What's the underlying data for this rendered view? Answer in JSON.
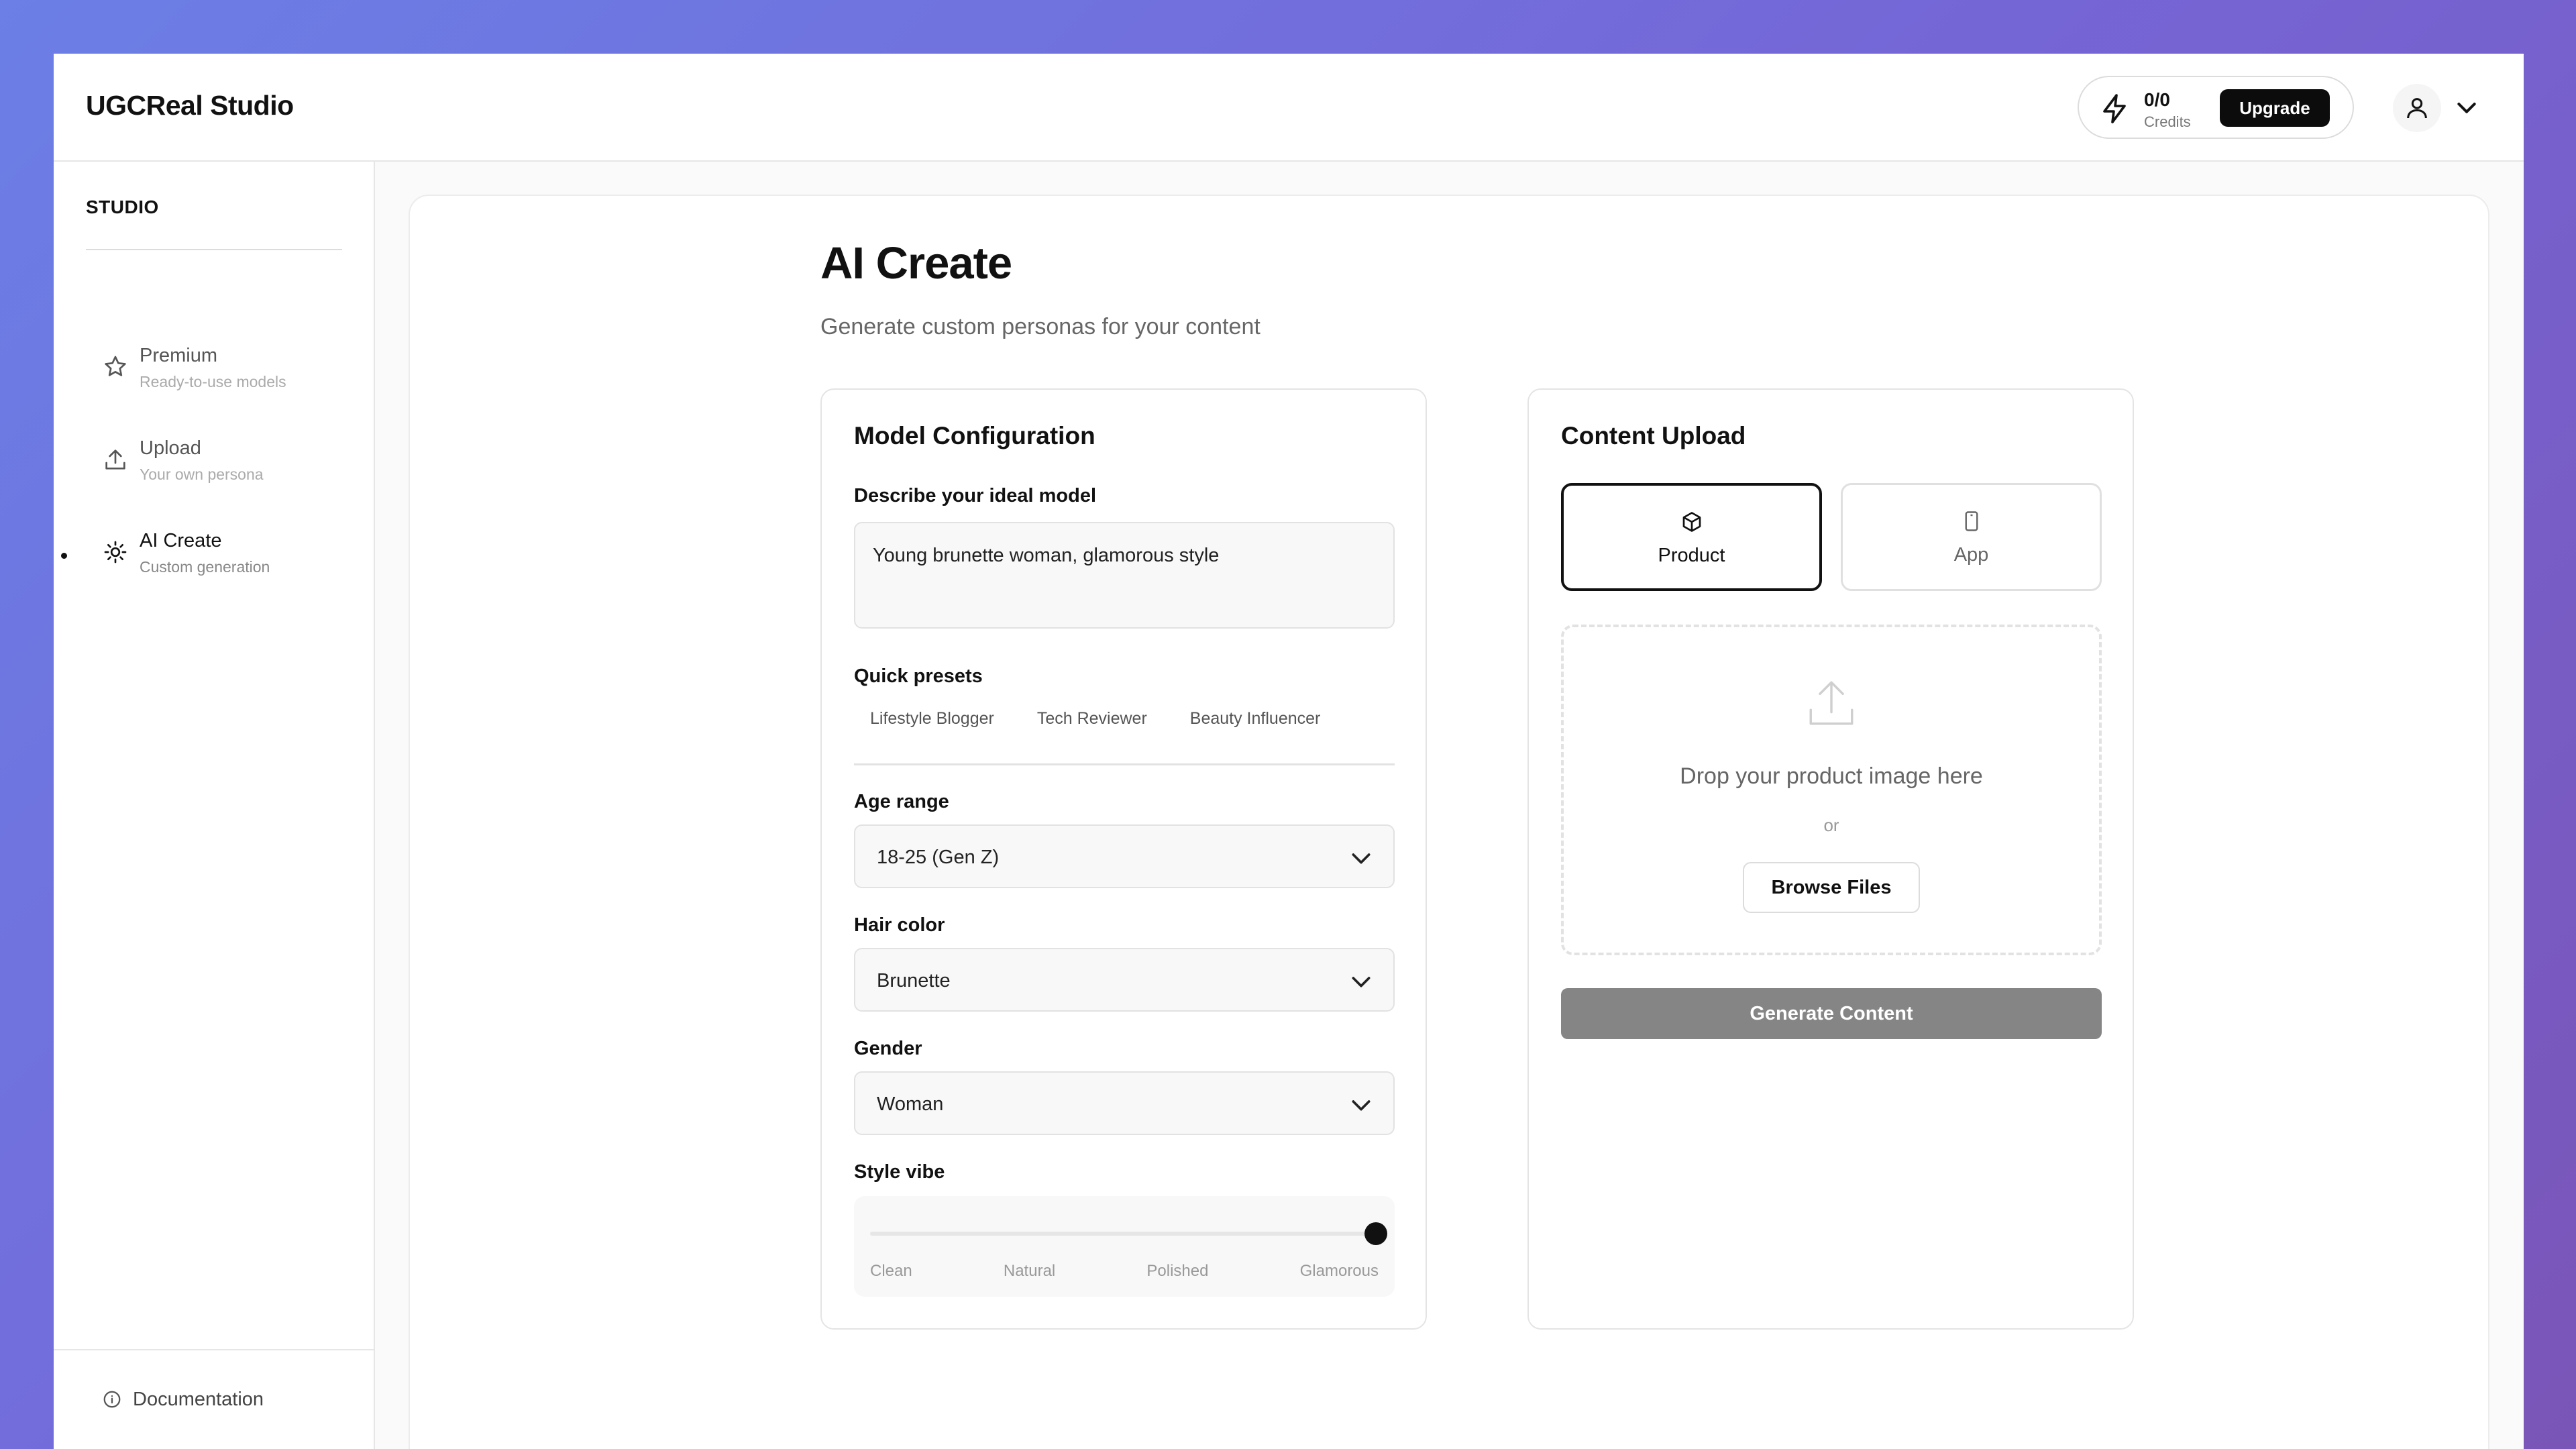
{
  "header": {
    "app_title": "UGCReal Studio",
    "credits_value": "0/0",
    "credits_label": "Credits",
    "upgrade_label": "Upgrade"
  },
  "sidebar": {
    "section_label": "STUDIO",
    "items": [
      {
        "title": "Premium",
        "subtitle": "Ready-to-use models",
        "icon": "star-icon",
        "active": false
      },
      {
        "title": "Upload",
        "subtitle": "Your own persona",
        "icon": "upload-icon",
        "active": false
      },
      {
        "title": "AI Create",
        "subtitle": "Custom generation",
        "icon": "sun-icon",
        "active": true
      }
    ],
    "docs_label": "Documentation"
  },
  "page": {
    "title": "AI Create",
    "subtitle": "Generate custom personas for your content"
  },
  "model_config": {
    "title": "Model Configuration",
    "describe_label": "Describe your ideal model",
    "describe_value": "Young brunette woman, glamorous style",
    "presets_label": "Quick presets",
    "presets": [
      "Lifestyle Blogger",
      "Tech Reviewer",
      "Beauty Influencer"
    ],
    "age_label": "Age range",
    "age_value": "18-25 (Gen Z)",
    "hair_label": "Hair color",
    "hair_value": "Brunette",
    "gender_label": "Gender",
    "gender_value": "Woman",
    "style_label": "Style vibe",
    "style_stops": [
      "Clean",
      "Natural",
      "Polished",
      "Glamorous"
    ],
    "style_level": 1.0
  },
  "content_upload": {
    "title": "Content Upload",
    "types": [
      {
        "label": "Product",
        "icon": "box-icon",
        "selected": true
      },
      {
        "label": "App",
        "icon": "phone-icon",
        "selected": false
      }
    ],
    "drop_text": "Drop your product image here",
    "or_text": "or",
    "browse_label": "Browse Files",
    "generate_label": "Generate Content"
  },
  "colors": {
    "accent": "#0c0c0c",
    "generate_disabled": "#858585",
    "background_gradient_start": "#6b7fe6",
    "background_gradient_end": "#7a55b8"
  }
}
